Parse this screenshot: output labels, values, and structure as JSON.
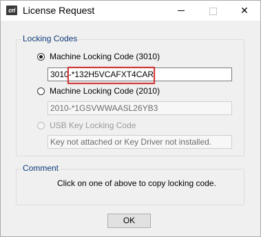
{
  "window": {
    "title": "License Request",
    "app_icon_text": "cri",
    "icon_names": [
      "app-icon",
      "minimize-icon",
      "maximize-icon",
      "close-icon"
    ]
  },
  "locking_codes": {
    "group_label": "Locking Codes",
    "options": [
      {
        "label": "Machine Locking Code (3010)",
        "selected": true,
        "enabled": true,
        "field_value": "3010-*132H5VCAFXT4CAR"
      },
      {
        "label": "Machine Locking Code (2010)",
        "selected": false,
        "enabled": true,
        "field_value": "2010-*1GSVWWAASL26YB3"
      },
      {
        "label": "USB Key Locking Code",
        "selected": false,
        "enabled": false,
        "field_value": "Key not attached or Key Driver not installed."
      }
    ]
  },
  "comment": {
    "group_label": "Comment",
    "text": "Click on one of above to copy locking code."
  },
  "buttons": {
    "ok_label": "OK"
  },
  "colors": {
    "group_label": "#0c3a7a",
    "highlight": "#d03535"
  }
}
